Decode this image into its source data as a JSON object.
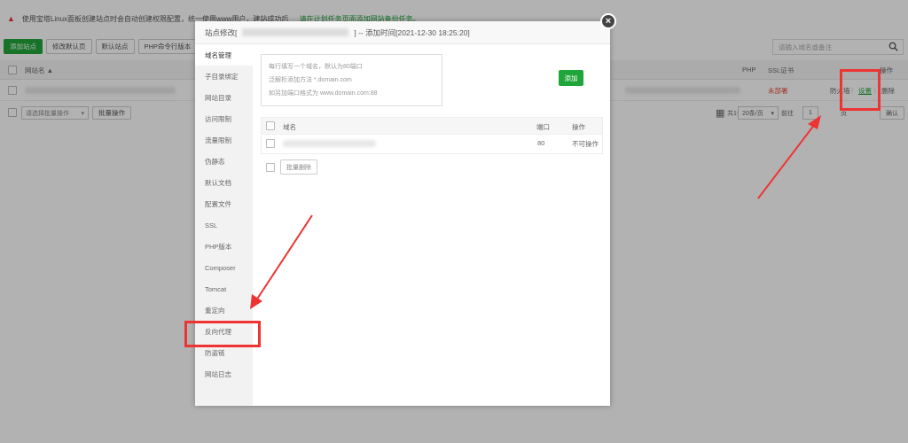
{
  "warning": {
    "text": "使用宝塔Linux面板创建站点时会自动创建权限配置，统一使用www用户，建站成功后",
    "link": "请在计划任务页面添加网站备份任务。"
  },
  "toolbar": {
    "add_site": "添加站点",
    "modify_default": "修改默认页",
    "default_site": "默认站点",
    "php_cli": "PHP命令行版本"
  },
  "search": {
    "placeholder": "请输入域名或备注"
  },
  "table": {
    "col_sitename": "网站名 ▲",
    "col_php": "PHP",
    "col_ssl": "SSL证书",
    "col_action": "操作",
    "row": {
      "ssl": "未部署",
      "firewall": "防火墙",
      "settings": "设置",
      "delete": "删除",
      "sep": "|"
    }
  },
  "footer": {
    "batch_select": "请选择批量操作",
    "batch_btn": "批量操作",
    "total": "共1条",
    "per_page": "20条/页",
    "goto": "前往",
    "page_num": "1",
    "page_unit": "页",
    "confirm": "确认"
  },
  "modal": {
    "title_prefix": "站点修改[",
    "title_suffix": "] -- 添加时间[2021-12-30 18:25:20]",
    "close": "×",
    "menu": [
      "域名管理",
      "子目录绑定",
      "网站目录",
      "访问限制",
      "流量限制",
      "伪静态",
      "默认文档",
      "配置文件",
      "SSL",
      "PHP版本",
      "Composer",
      "Tomcat",
      "重定向",
      "反向代理",
      "防盗链",
      "网站日志"
    ],
    "hints": [
      "每行填写一个域名，默认为80端口",
      "泛解析添加方法 *.domain.com",
      "如另加端口格式为 www.domain.com:88"
    ],
    "add_btn": "添加",
    "domain_table": {
      "col_domain": "域名",
      "col_port": "端口",
      "col_action": "操作",
      "rows": [
        {
          "port": "80",
          "action": "不可操作"
        }
      ]
    },
    "bulk_delete": "批量删除"
  }
}
